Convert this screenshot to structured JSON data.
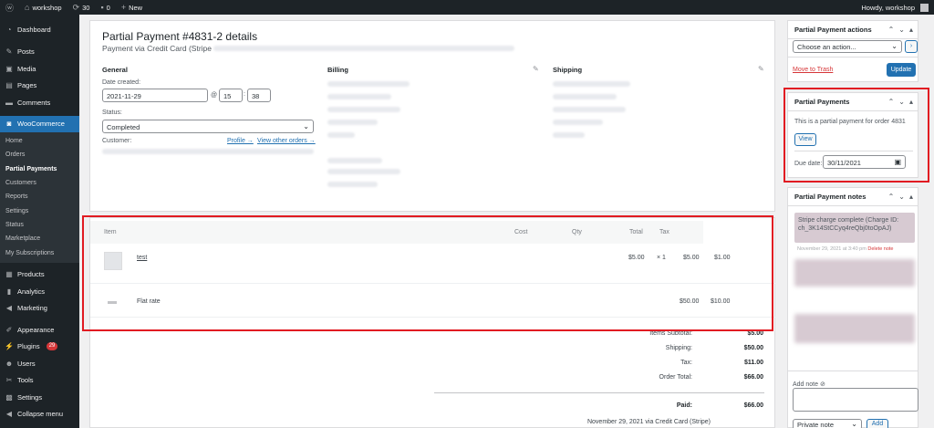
{
  "adminbar": {
    "wp_logo": "wordpress-icon",
    "site_name": "workshop",
    "updates_count": "30",
    "comments_count": "0",
    "new_label": "New",
    "howdy": "Howdy, workshop"
  },
  "sidebar": {
    "items": [
      {
        "label": "Dashboard",
        "icon": "dashboard-icon"
      },
      {
        "label": "Posts",
        "icon": "pin-icon"
      },
      {
        "label": "Media",
        "icon": "media-icon"
      },
      {
        "label": "Pages",
        "icon": "pages-icon"
      },
      {
        "label": "Comments",
        "icon": "comments-icon"
      },
      {
        "label": "WooCommerce",
        "icon": "woocommerce-icon"
      }
    ],
    "submenu": [
      "Home",
      "Orders",
      "Partial Payments",
      "Customers",
      "Reports",
      "Settings",
      "Status",
      "Marketplace",
      "My Subscriptions"
    ],
    "items2": [
      {
        "label": "Products",
        "icon": "products-icon"
      },
      {
        "label": "Analytics",
        "icon": "analytics-icon"
      },
      {
        "label": "Marketing",
        "icon": "marketing-icon"
      },
      {
        "label": "Appearance",
        "icon": "appearance-icon"
      },
      {
        "label": "Plugins",
        "icon": "plugins-icon",
        "badge": "29"
      },
      {
        "label": "Users",
        "icon": "users-icon"
      },
      {
        "label": "Tools",
        "icon": "tools-icon"
      },
      {
        "label": "Settings",
        "icon": "settings-icon"
      },
      {
        "label": "Collapse menu",
        "icon": "collapse-icon"
      }
    ]
  },
  "order": {
    "title": "Partial Payment #4831-2 details",
    "subtitle": "Payment via Credit Card (Stripe",
    "general_heading": "General",
    "billing_heading": "Billing",
    "shipping_heading": "Shipping",
    "date_label": "Date created:",
    "date_value": "2021-11-29",
    "hour": "15",
    "minute": "38",
    "status_label": "Status:",
    "status_value": "Completed",
    "customer_label": "Customer:",
    "profile_link": "Profile →",
    "other_orders_link": "View other orders →"
  },
  "items": {
    "headers": {
      "item": "Item",
      "cost": "Cost",
      "qty": "Qty",
      "total": "Total",
      "tax": "Tax"
    },
    "line_item": {
      "name": "test",
      "cost": "$5.00",
      "qty": "× 1",
      "total": "$5.00",
      "tax": "$1.00"
    },
    "shipping_item": {
      "name": "Flat rate",
      "total": "$50.00",
      "tax": "$10.00"
    },
    "totals": [
      {
        "label": "Items Subtotal:",
        "value": "$5.00"
      },
      {
        "label": "Shipping:",
        "value": "$50.00"
      },
      {
        "label": "Tax:",
        "value": "$11.00"
      },
      {
        "label": "Order Total:",
        "value": "$66.00"
      }
    ],
    "paid_label": "Paid:",
    "paid_value": "$66.00",
    "paid_note": "November 29, 2021 via Credit Card (Stripe)"
  },
  "actions_box": {
    "title": "Partial Payment actions",
    "select_placeholder": "Choose an action...",
    "trash_link": "Move to Trash",
    "update_button": "Update"
  },
  "partial_box": {
    "title": "Partial Payments",
    "text": "This is a partial payment for order 4831",
    "view_button": "View",
    "due_label": "Due date:",
    "due_value": "30/11/2021"
  },
  "notes_box": {
    "title": "Partial Payment notes",
    "note1_line1": "Stripe charge complete (Charge ID:",
    "note1_line2": "ch_3K14StCCyq4reQbj0toOpAJ)",
    "note1_meta": "November 29, 2021 at 3:40 pm",
    "delete_note": "Delete note",
    "add_note_label": "Add note",
    "note_type": "Private note",
    "add_button": "Add"
  },
  "colors": {
    "accent": "#2271b1",
    "highlight": "#e11b22",
    "admin_dark": "#1d2327"
  }
}
